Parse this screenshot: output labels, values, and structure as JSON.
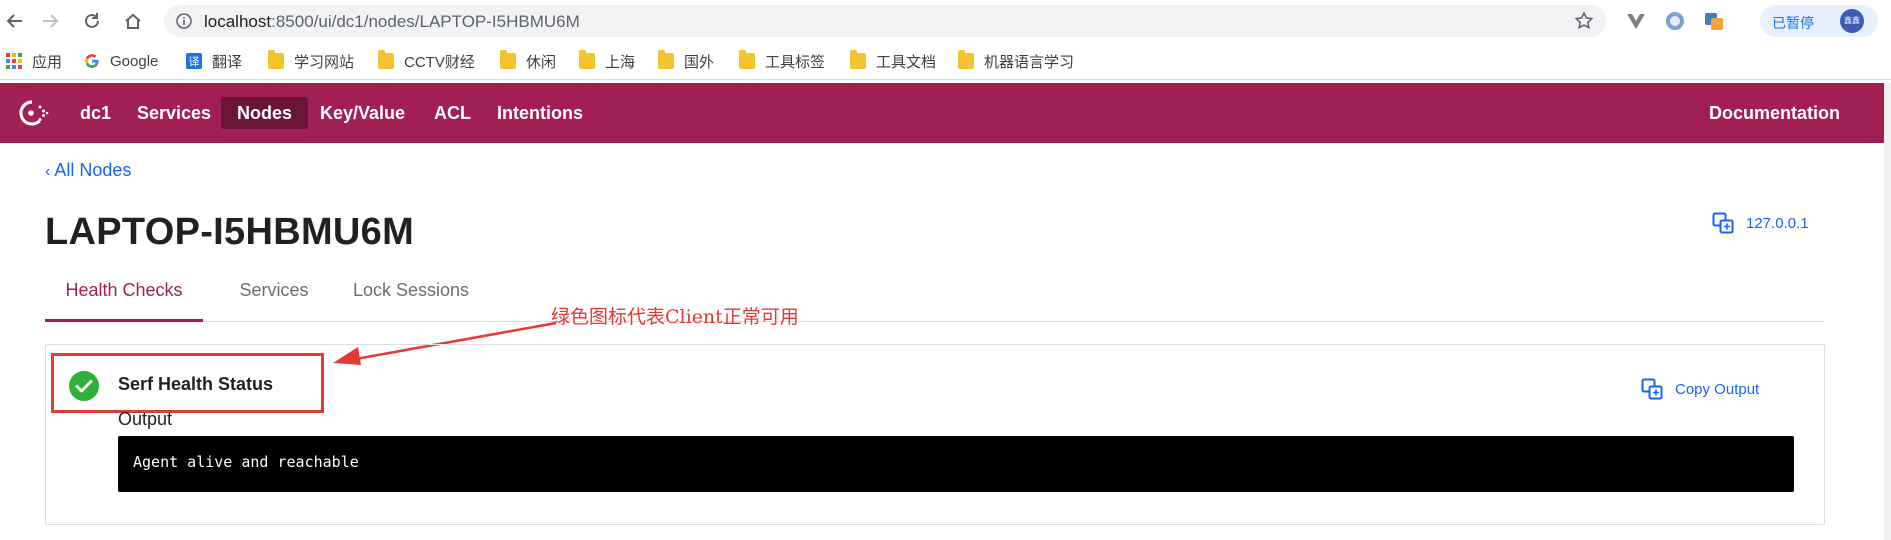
{
  "browser": {
    "url_host": "localhost",
    "url_path": ":8500/ui/dc1/nodes/LAPTOP-I5HBMU6M",
    "profile_label": "已暂停",
    "profile_avatar_text": "鑫鑫"
  },
  "bookmarks": [
    {
      "label": "应用",
      "icon": "apps-grid-icon"
    },
    {
      "label": "Google",
      "icon": "google-icon"
    },
    {
      "label": "翻译",
      "icon": "translate-icon"
    },
    {
      "label": "学习网站",
      "icon": "folder-icon"
    },
    {
      "label": "CCTV财经",
      "icon": "folder-icon"
    },
    {
      "label": "休闲",
      "icon": "folder-icon"
    },
    {
      "label": "上海",
      "icon": "folder-icon"
    },
    {
      "label": "国外",
      "icon": "folder-icon"
    },
    {
      "label": "工具标签",
      "icon": "folder-icon"
    },
    {
      "label": "工具文档",
      "icon": "folder-icon"
    },
    {
      "label": "机器语言学习",
      "icon": "folder-icon"
    }
  ],
  "appbar": {
    "datacenter": "dc1",
    "nav": [
      "Services",
      "Nodes",
      "Key/Value",
      "ACL",
      "Intentions"
    ],
    "active_nav": "Nodes",
    "documentation": "Documentation",
    "brand_color": "#a21f56"
  },
  "page": {
    "back_link": "All Nodes",
    "title": "LAPTOP-I5HBMU6M",
    "address": "127.0.0.1",
    "tabs": [
      "Health Checks",
      "Services",
      "Lock Sessions"
    ],
    "active_tab": "Health Checks"
  },
  "annotation": "绿色图标代表Client正常可用",
  "health_check": {
    "name": "Serf Health Status",
    "status": "passing",
    "status_color": "#2eb039",
    "copy_label": "Copy Output",
    "output_label": "Output",
    "output": "Agent alive and reachable"
  }
}
